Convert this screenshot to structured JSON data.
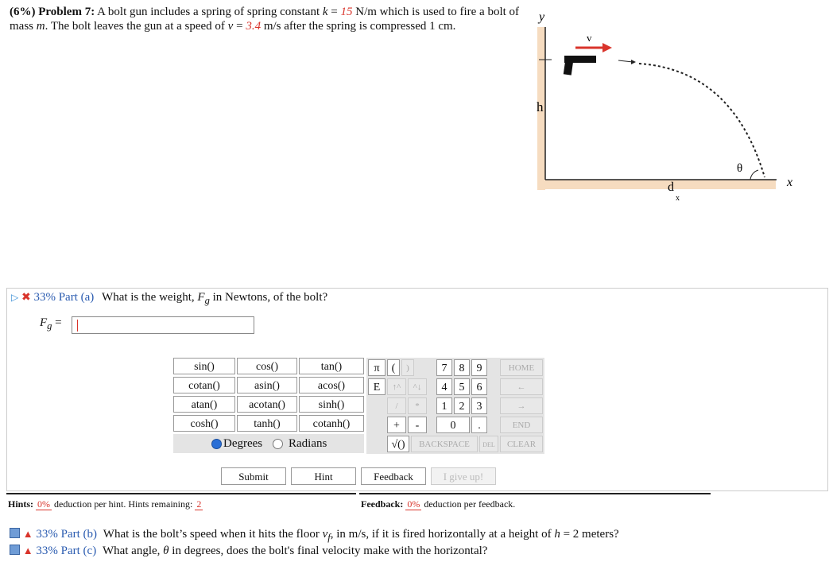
{
  "problem": {
    "header": "(6%) Problem 7:",
    "text_a": "A bolt gun includes a spring of spring constant",
    "k_symbol": "k",
    "k_eq": " = ",
    "k_value": "15",
    "text_b": " N/m which is used to fire a bolt of mass",
    "m_symbol": "m",
    "text_c": ". The bolt leaves the gun at a speed of",
    "v_symbol": "v",
    "v_eq": " = ",
    "v_value": "3.4",
    "text_d": " m/s after the spring is compressed 1 cm."
  },
  "figure": {
    "y_label": "y",
    "x_label": "x",
    "h_label": "h",
    "v_label": "v",
    "theta_label": "θ",
    "d_label": "d",
    "d_sub": "x"
  },
  "partA": {
    "percent": "33%",
    "part_label": "Part (a)",
    "question": "What is the weight,",
    "symbol": "F",
    "symbol_sub": "g",
    "question_tail": "in Newtons, of the bolt?",
    "answer_label_main": "F",
    "answer_label_sub": "g",
    "answer_eq": " =",
    "answer_value": ""
  },
  "fnpad": {
    "rows": [
      [
        "sin()",
        "cos()",
        "tan()"
      ],
      [
        "cotan()",
        "asin()",
        "acos()"
      ],
      [
        "atan()",
        "acotan()",
        "sinh()"
      ],
      [
        "cosh()",
        "tanh()",
        "cotanh()"
      ]
    ],
    "degrees": "Degrees",
    "radians": "Radians",
    "angle_mode": "Degrees"
  },
  "numpad": {
    "pi": "π",
    "e": "E",
    "lparen": "(",
    "rparen": ")",
    "up": "↑^",
    "down": "^↓",
    "div": "/",
    "mul": "*",
    "plus": "+",
    "minus": "-",
    "sqrt": "√()",
    "digits": [
      "7",
      "8",
      "9",
      "4",
      "5",
      "6",
      "1",
      "2",
      "3",
      "0",
      "."
    ],
    "home": "HOME",
    "left": "←",
    "right": "→",
    "end": "END",
    "backspace": "BACKSPACE",
    "del": "DEL",
    "clear": "CLEAR"
  },
  "actions": {
    "submit": "Submit",
    "hint": "Hint",
    "feedback": "Feedback",
    "give_up": "I give up!"
  },
  "hints": {
    "label": "Hints:",
    "pct": "0%",
    "text": "deduction per hint. Hints remaining:",
    "remaining": "2"
  },
  "feedback": {
    "label": "Feedback:",
    "pct": "0%",
    "text": "deduction per feedback."
  },
  "partB": {
    "percent": "33%",
    "part_label": "Part (b)",
    "question": "What is the bolt’s speed when it hits the floor",
    "symbol": "v",
    "symbol_sub": "f",
    "question_tail": ", in m/s, if it is fired horizontally at a height of",
    "h_symbol": "h",
    "h_tail": " = 2 meters?"
  },
  "partC": {
    "percent": "33%",
    "part_label": "Part (c)",
    "question": "What angle,",
    "symbol": "θ",
    "question_tail": "in degrees, does the bolt's final velocity make with the horizontal?"
  },
  "colors": {
    "accent_red": "#d9342b",
    "accent_blue": "#2a5bb0",
    "figure_wall": "#f6dcc0"
  }
}
